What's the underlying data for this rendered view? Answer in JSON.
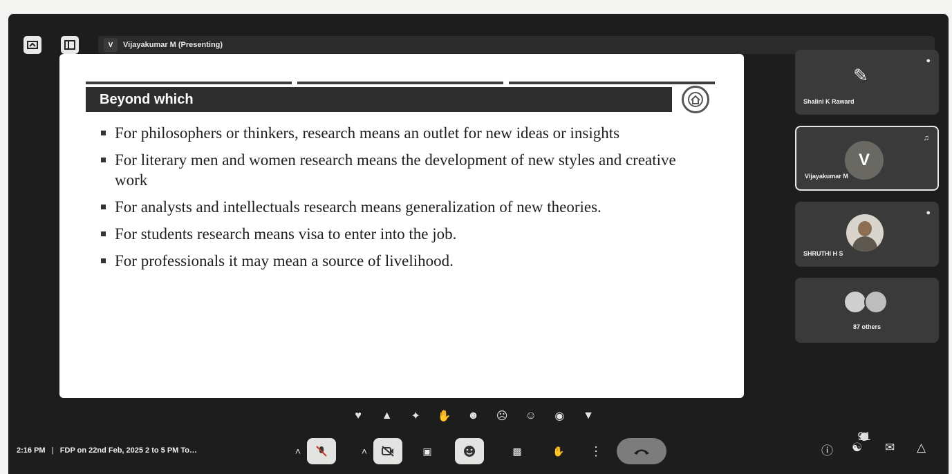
{
  "topbar": {
    "presenter_initial": "V",
    "presenter_label": "Vijayakumar M (Presenting)"
  },
  "slide": {
    "title": "Beyond which",
    "bullets": [
      "For philosophers or thinkers, research means an outlet for new ideas or insights",
      "For literary men and women research means the development of new styles and creative work",
      "For analysts and intellectuals research means generalization of new theories.",
      "For students research means visa to enter into the job.",
      "For professionals it may mean a source of livelihood."
    ]
  },
  "participants": [
    {
      "name": "Shalini K Raward",
      "muted": true
    },
    {
      "name": "Vijayakumar M",
      "initial": "V",
      "speaking": true
    },
    {
      "name": "SHRUTHI H S",
      "muted": true
    },
    {
      "name": "87 others"
    }
  ],
  "reactions": [
    "heart",
    "thumbs-up",
    "party",
    "clap",
    "laugh",
    "surprised",
    "sad",
    "thinking",
    "thumbs-down"
  ],
  "bottombar": {
    "time": "2:16 PM",
    "meeting_title": "FDP on 22nd Feb, 2025 2 to 5 PM To…",
    "people_count": "91"
  },
  "colors": {
    "background": "#1d1d1e",
    "tile": "#3a3a3b",
    "end_call": "#7c7c7c"
  }
}
